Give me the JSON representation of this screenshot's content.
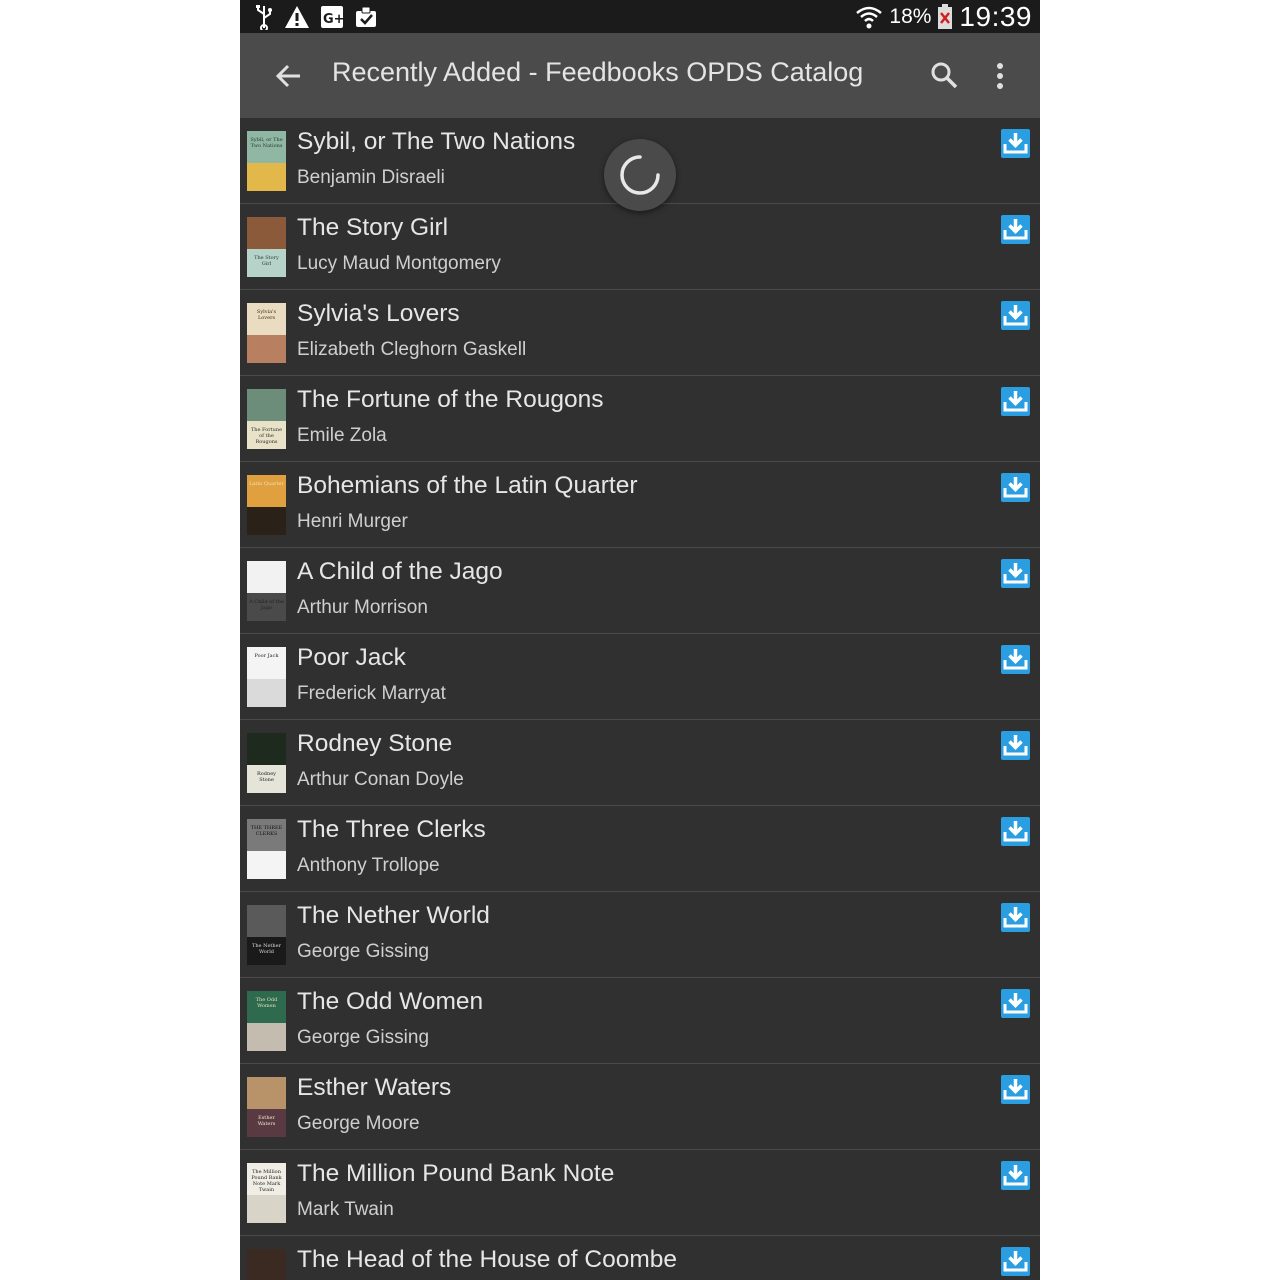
{
  "status_bar": {
    "battery_percent": "18%",
    "time": "19:39",
    "icons": [
      "usb-icon",
      "warning-icon",
      "google-plus-icon",
      "clipboard-check-icon",
      "wifi-icon",
      "battery-icon"
    ]
  },
  "app_bar": {
    "title": "Recently Added - Feedbooks OPDS Catalog",
    "back_icon": "arrow-back-icon",
    "search_icon": "search-icon",
    "menu_icon": "overflow-menu-icon"
  },
  "books": [
    {
      "title": "Sybil, or The Two Nations",
      "author": "Benjamin Disraeli",
      "cover": {
        "top": "#8fb7a4",
        "bottom": "#e3b84a",
        "text": "#2b3a2a",
        "label": "Sybil, or The Two Nations"
      }
    },
    {
      "title": "The Story Girl",
      "author": "Lucy Maud Montgomery",
      "cover": {
        "top": "#8b5a3a",
        "bottom": "#b5d3c9",
        "text": "#2a3a3a",
        "label": "The Story Girl"
      }
    },
    {
      "title": "Sylvia's Lovers",
      "author": "Elizabeth Cleghorn Gaskell",
      "cover": {
        "top": "#e9dcc0",
        "bottom": "#b88060",
        "text": "#3a2a1a",
        "label": "Sylvia's Lovers"
      }
    },
    {
      "title": "The Fortune of the Rougons",
      "author": "Emile Zola",
      "cover": {
        "top": "#6b8d7a",
        "bottom": "#e8e3c8",
        "text": "#2a2a2a",
        "label": "The Fortune of the Rougons"
      }
    },
    {
      "title": "Bohemians of the Latin Quarter",
      "author": "Henri Murger",
      "cover": {
        "top": "#e0a040",
        "bottom": "#2a2218",
        "text": "#f0e0b0",
        "label": "Latin Quarter"
      }
    },
    {
      "title": "A Child of the Jago",
      "author": "Arthur Morrison",
      "cover": {
        "top": "#f2f2f2",
        "bottom": "#4a4a4a",
        "text": "#222222",
        "label": "A Child of the Jago"
      }
    },
    {
      "title": "Poor Jack",
      "author": "Frederick Marryat",
      "cover": {
        "top": "#f4f4f4",
        "bottom": "#dadada",
        "text": "#222222",
        "label": "Poor Jack"
      }
    },
    {
      "title": "Rodney Stone",
      "author": "Arthur Conan Doyle",
      "cover": {
        "top": "#1e2a1e",
        "bottom": "#e4e4d8",
        "text": "#1a1a1a",
        "label": "Rodney Stone"
      }
    },
    {
      "title": "The Three Clerks",
      "author": "Anthony Trollope",
      "cover": {
        "top": "#7a7a7a",
        "bottom": "#f4f4f4",
        "text": "#111111",
        "label": "THE THREE CLERKS"
      }
    },
    {
      "title": "The Nether World",
      "author": "George Gissing",
      "cover": {
        "top": "#5a5a5a",
        "bottom": "#1a1a1a",
        "text": "#dddddd",
        "label": "The Nether World"
      }
    },
    {
      "title": "The Odd Women",
      "author": "George Gissing",
      "cover": {
        "top": "#2e6a4e",
        "bottom": "#c4bcae",
        "text": "#e8e0c0",
        "label": "The Odd Women"
      }
    },
    {
      "title": "Esther Waters",
      "author": "George Moore",
      "cover": {
        "top": "#b89268",
        "bottom": "#5a3a42",
        "text": "#f4e8d0",
        "label": "Esther Waters"
      }
    },
    {
      "title": "The Million Pound Bank Note",
      "author": "Mark Twain",
      "cover": {
        "top": "#f0ede4",
        "bottom": "#d8d4c8",
        "text": "#222222",
        "label": "The Million Pound Bank Note Mark Twain"
      }
    },
    {
      "title": "The Head of the House of Coombe",
      "author": "",
      "cover": {
        "top": "#3a2a22",
        "bottom": "#6a4a3a",
        "text": "#e8c8a0",
        "label": "The Head of the House of Coombe"
      }
    }
  ],
  "colors": {
    "background": "#303030",
    "app_bar": "#4b4b4b",
    "status_bar": "#1b1b1b",
    "download_accent": "#2a9ee0"
  }
}
